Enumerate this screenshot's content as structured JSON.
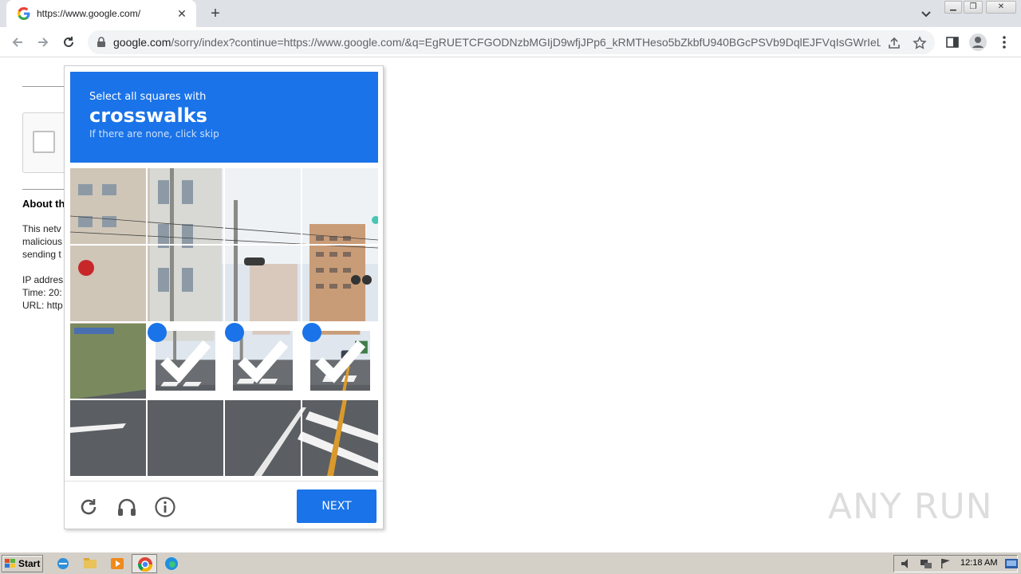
{
  "browser": {
    "tab_title": "https://www.google.com/",
    "tab_close": "✕",
    "new_tab": "+",
    "url_host": "google.com",
    "url_path": "/sorry/index?continue=https://www.google.com/&q=EgRUETCFGODNzbMGIjD9wfjJPp6_kRMTHeso5bZkbfU940BGcPSVb9DqlEJFVqIsGWrIeLui..."
  },
  "background_page": {
    "about_heading": "About th",
    "para_line1": "This netv",
    "para_line2": "malicious",
    "para_line3": "sending t",
    "ip_line": "IP addres",
    "time_line": "Time: 20:",
    "url_line": "URL: http"
  },
  "captcha": {
    "instruction": "Select all squares with",
    "target": "crosswalks",
    "hint": "If there are none, click skip",
    "next_label": "NEXT",
    "selected_tiles": [
      9,
      10,
      11
    ]
  },
  "watermark": "ANY RUN",
  "taskbar": {
    "start_label": "Start",
    "clock": "12:18 AM"
  },
  "colors": {
    "accent": "#1a73e8",
    "tab_strip": "#dee1e6",
    "taskbar": "#d4d0c8"
  }
}
